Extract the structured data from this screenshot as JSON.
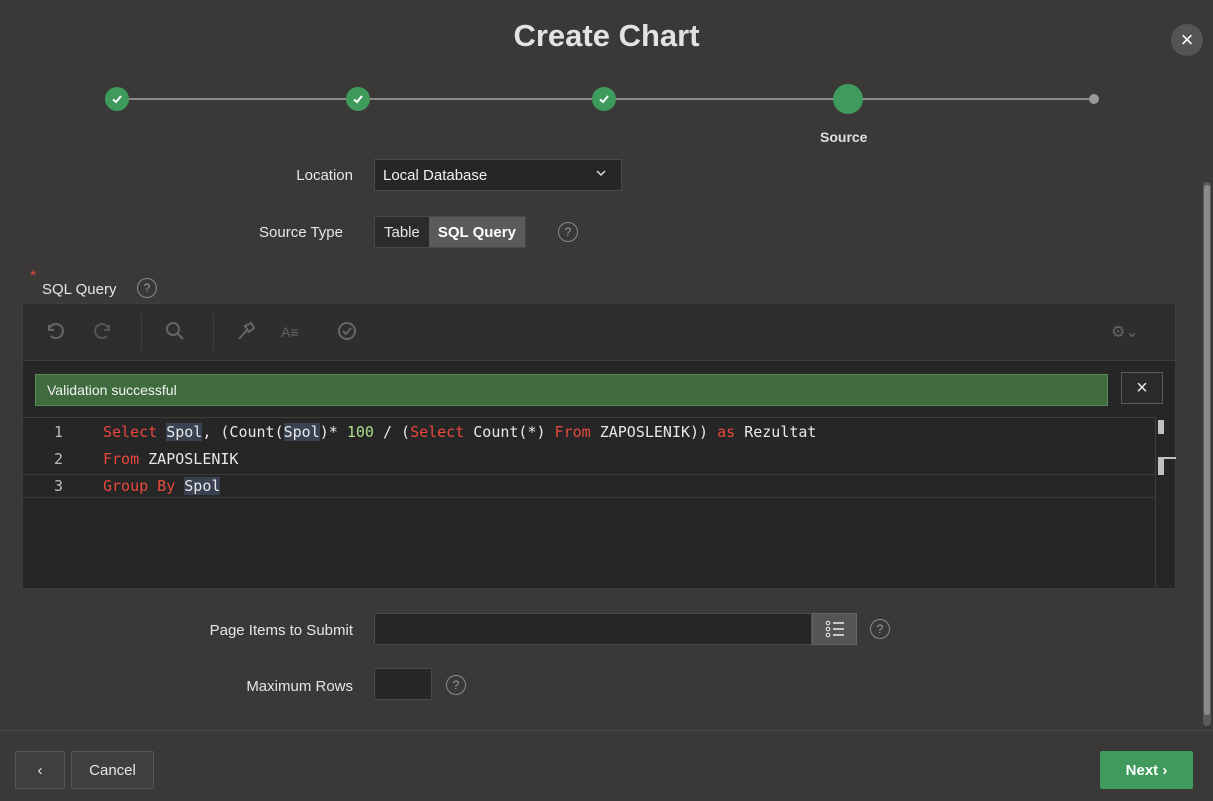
{
  "dialog": {
    "title": "Create Chart",
    "close_icon": "close-icon"
  },
  "wizard": {
    "steps": [
      {
        "state": "complete",
        "icon": "check-icon"
      },
      {
        "state": "complete",
        "icon": "check-icon"
      },
      {
        "state": "complete",
        "icon": "check-icon"
      },
      {
        "state": "active",
        "label": "Source"
      },
      {
        "state": "upcoming"
      }
    ],
    "active_label": "Source"
  },
  "form": {
    "location": {
      "label": "Location",
      "value": "Local Database"
    },
    "source_type": {
      "label": "Source Type",
      "options": [
        "Table",
        "SQL Query"
      ],
      "selected": "SQL Query"
    },
    "sql_query": {
      "label": "SQL Query",
      "required": true
    },
    "page_items": {
      "label": "Page Items to Submit",
      "value": ""
    },
    "max_rows": {
      "label": "Maximum Rows",
      "value": ""
    }
  },
  "editor": {
    "validation_message": "Validation successful",
    "lines": [
      {
        "num": "1"
      },
      {
        "num": "2"
      },
      {
        "num": "3"
      }
    ],
    "tokens": {
      "l1_a": "Select",
      "l1_b": "Spol",
      "l1_c": ", (Count(",
      "l1_d": "Spol",
      "l1_e": ")* ",
      "l1_f": "100",
      "l1_g": " / (",
      "l1_h": "Select",
      "l1_i": " Count(*) ",
      "l1_j": "From",
      "l1_k": " ZAPOSLENIK)) ",
      "l1_l": "as",
      "l1_m": " Rezultat",
      "l2_a": "From",
      "l2_b": " ZAPOSLENIK",
      "l3_a": "Group By",
      "l3_b": "Spol"
    }
  },
  "footer": {
    "back_icon": "‹",
    "cancel_label": "Cancel",
    "next_label": "Next ›"
  },
  "colors": {
    "accent": "#3f9b5b",
    "keyword": "#e8483d",
    "validation_bg": "#3f6b3f"
  }
}
